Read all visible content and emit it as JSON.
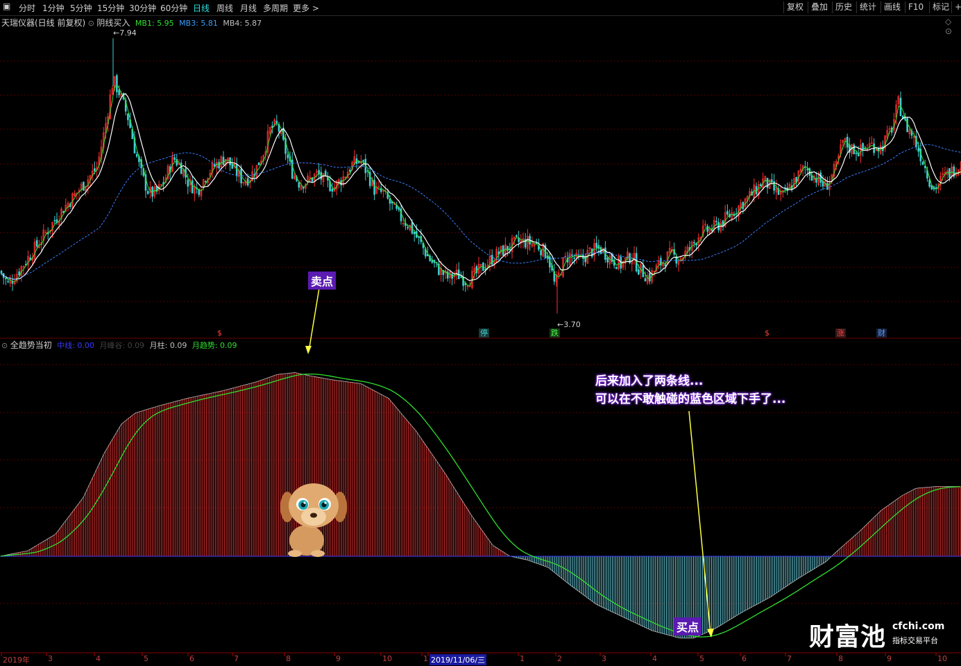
{
  "toolbar": {
    "periods": [
      "分时",
      "1分钟",
      "5分钟",
      "15分钟",
      "30分钟",
      "60分钟",
      "日线",
      "周线",
      "月线",
      "多周期",
      "更多 >"
    ],
    "active": "日线",
    "right": [
      "复权",
      "叠加",
      "历史",
      "统计",
      "画线",
      "F10",
      "标记",
      "+"
    ]
  },
  "main_header": {
    "stock": "天瑞仪器(日线 前复权)",
    "indicator": "阴线买入",
    "mb1_label": "MB1: 5.95",
    "mb3_label": "MB3: 5.81",
    "mb4_label": "MB4: 5.87"
  },
  "sub_header": {
    "name": "全趋势当初",
    "zx_label": "中线: 0.00",
    "yfg_label": "月峰谷: 0.09",
    "yz_label": "月柱: 0.09",
    "yqs_label": "月趋势: 0.09"
  },
  "price_high_label": "7.94",
  "price_low_label": "3.70",
  "markers": [
    {
      "text": "$",
      "color": "#ff4040"
    },
    {
      "text": "停",
      "color": "#3fd0d0"
    },
    {
      "text": "跌",
      "color": "#40ff40"
    },
    {
      "text": "$",
      "color": "#ff4040"
    },
    {
      "text": "涨",
      "color": "#ff4040"
    },
    {
      "text": "财",
      "color": "#5aa0ff"
    }
  ],
  "annotations": {
    "sell": "卖点",
    "buy": "买点",
    "note_line1": "后来加入了两条线...",
    "note_line2": "可以在不敢触碰的蓝色区域下手了..."
  },
  "date_axis": {
    "labels": [
      "2019年",
      "3",
      "4",
      "5",
      "6",
      "7",
      "8",
      "9",
      "10",
      "1",
      "2019/11/06/三",
      "1",
      "2",
      "3",
      "4",
      "5",
      "6",
      "7",
      "8",
      "9",
      "10"
    ],
    "highlighted": "2019/11/06/三"
  },
  "watermark": {
    "main": "财富池",
    "domain": "cfchi.com",
    "tagline": "指标交易平台"
  },
  "colors": {
    "up": "#ff3030",
    "down": "#3fd0d0",
    "ma_white": "#ffffff",
    "ma_green": "#30e030",
    "ma_blue_dashed": "#3a7fff",
    "hist_red": "#e03030",
    "hist_cyan": "#6ad0e0",
    "trend_green": "#30e030",
    "annot_bg": "#5a1bb0",
    "arrow_yellow": "#ffff40"
  },
  "chart_data": {
    "type": "line",
    "price_series_shape": [
      [
        0,
        4.35
      ],
      [
        12,
        4.15
      ],
      [
        30,
        4.4
      ],
      [
        50,
        4.7
      ],
      [
        70,
        5.0
      ],
      [
        90,
        5.3
      ],
      [
        110,
        5.55
      ],
      [
        125,
        5.75
      ],
      [
        140,
        5.95
      ],
      [
        152,
        6.6
      ],
      [
        163,
        7.3
      ],
      [
        172,
        7.1
      ],
      [
        185,
        6.7
      ],
      [
        195,
        6.2
      ],
      [
        205,
        5.8
      ],
      [
        215,
        5.55
      ],
      [
        225,
        5.55
      ],
      [
        235,
        5.7
      ],
      [
        250,
        6.1
      ],
      [
        262,
        5.95
      ],
      [
        272,
        5.7
      ],
      [
        285,
        5.6
      ],
      [
        298,
        5.85
      ],
      [
        312,
        6.0
      ],
      [
        325,
        6.1
      ],
      [
        338,
        5.9
      ],
      [
        350,
        5.75
      ],
      [
        360,
        5.8
      ],
      [
        370,
        5.95
      ],
      [
        380,
        6.2
      ],
      [
        390,
        6.55
      ],
      [
        400,
        6.6
      ],
      [
        410,
        6.25
      ],
      [
        420,
        5.9
      ],
      [
        432,
        5.7
      ],
      [
        445,
        5.75
      ],
      [
        458,
        5.85
      ],
      [
        470,
        5.7
      ],
      [
        482,
        5.65
      ],
      [
        495,
        5.8
      ],
      [
        508,
        6.0
      ],
      [
        520,
        6.05
      ],
      [
        530,
        5.85
      ],
      [
        540,
        5.6
      ],
      [
        552,
        5.55
      ],
      [
        565,
        5.35
      ],
      [
        575,
        5.2
      ],
      [
        590,
        5.05
      ],
      [
        605,
        4.8
      ],
      [
        618,
        4.55
      ],
      [
        630,
        4.4
      ],
      [
        645,
        4.25
      ],
      [
        660,
        4.3
      ],
      [
        672,
        4.2
      ],
      [
        685,
        4.3
      ],
      [
        700,
        4.45
      ],
      [
        715,
        4.6
      ],
      [
        730,
        4.7
      ],
      [
        745,
        4.8
      ],
      [
        760,
        4.8
      ],
      [
        775,
        4.75
      ],
      [
        790,
        4.6
      ],
      [
        800,
        4.1
      ],
      [
        810,
        4.45
      ],
      [
        820,
        4.6
      ],
      [
        835,
        4.5
      ],
      [
        850,
        4.65
      ],
      [
        865,
        4.7
      ],
      [
        880,
        4.55
      ],
      [
        895,
        4.45
      ],
      [
        910,
        4.6
      ],
      [
        920,
        4.4
      ],
      [
        935,
        4.25
      ],
      [
        950,
        4.45
      ],
      [
        965,
        4.6
      ],
      [
        980,
        4.55
      ],
      [
        995,
        4.7
      ],
      [
        1010,
        4.95
      ],
      [
        1025,
        5.0
      ],
      [
        1040,
        5.1
      ],
      [
        1055,
        5.25
      ],
      [
        1070,
        5.4
      ],
      [
        1085,
        5.55
      ],
      [
        1100,
        5.75
      ],
      [
        1115,
        5.6
      ],
      [
        1130,
        5.5
      ],
      [
        1145,
        5.75
      ],
      [
        1160,
        5.95
      ],
      [
        1175,
        5.8
      ],
      [
        1190,
        5.65
      ],
      [
        1205,
        5.95
      ],
      [
        1215,
        6.35
      ],
      [
        1225,
        6.25
      ],
      [
        1240,
        6.2
      ],
      [
        1255,
        6.3
      ],
      [
        1270,
        6.25
      ],
      [
        1285,
        6.55
      ],
      [
        1295,
        6.95
      ],
      [
        1305,
        6.6
      ],
      [
        1315,
        6.45
      ],
      [
        1330,
        6.05
      ],
      [
        1345,
        5.6
      ],
      [
        1360,
        5.8
      ],
      [
        1385,
        6.0
      ]
    ],
    "price_ylim": [
      3.5,
      8.1
    ],
    "trend_histogram_shape": [
      [
        0,
        0.0
      ],
      [
        40,
        0.03
      ],
      [
        80,
        0.12
      ],
      [
        120,
        0.32
      ],
      [
        150,
        0.56
      ],
      [
        175,
        0.72
      ],
      [
        195,
        0.78
      ],
      [
        230,
        0.82
      ],
      [
        270,
        0.86
      ],
      [
        320,
        0.9
      ],
      [
        370,
        0.95
      ],
      [
        400,
        0.99
      ],
      [
        425,
        1.0
      ],
      [
        450,
        0.98
      ],
      [
        480,
        0.96
      ],
      [
        520,
        0.94
      ],
      [
        560,
        0.86
      ],
      [
        600,
        0.68
      ],
      [
        640,
        0.46
      ],
      [
        680,
        0.22
      ],
      [
        710,
        0.06
      ],
      [
        735,
        0.0
      ],
      [
        760,
        -0.02
      ],
      [
        790,
        -0.06
      ],
      [
        820,
        -0.15
      ],
      [
        860,
        -0.26
      ],
      [
        900,
        -0.33
      ],
      [
        940,
        -0.4
      ],
      [
        980,
        -0.44
      ],
      [
        1000,
        -0.44
      ],
      [
        1030,
        -0.39
      ],
      [
        1070,
        -0.3
      ],
      [
        1110,
        -0.22
      ],
      [
        1150,
        -0.12
      ],
      [
        1190,
        -0.03
      ],
      [
        1210,
        0.04
      ],
      [
        1240,
        0.14
      ],
      [
        1270,
        0.25
      ],
      [
        1300,
        0.33
      ],
      [
        1320,
        0.37
      ],
      [
        1350,
        0.38
      ],
      [
        1385,
        0.38
      ]
    ],
    "trend_ylim": [
      -0.5,
      1.1
    ]
  }
}
